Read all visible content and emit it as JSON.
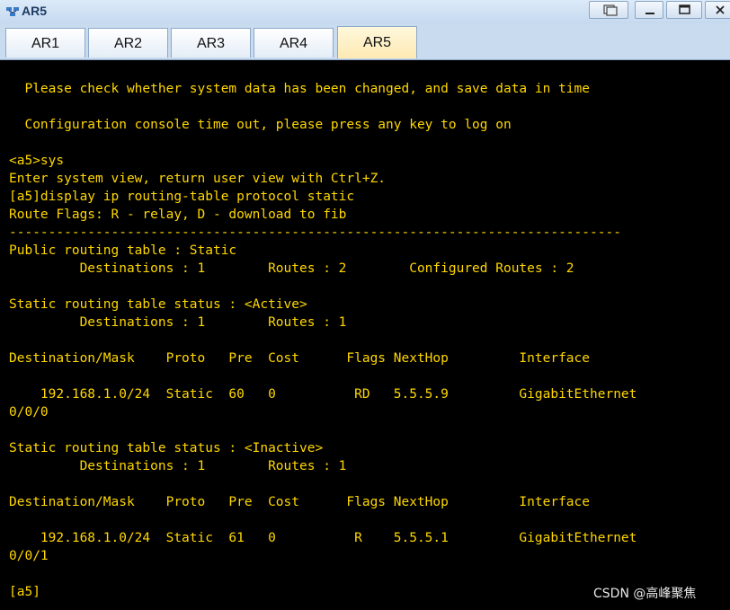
{
  "window": {
    "title": "AR5",
    "restore_icon": "restore-icon",
    "minimize_icon": "minimize-icon",
    "maximize_icon": "maximize-icon",
    "close_icon": "close-icon"
  },
  "tabs": [
    {
      "label": "AR1",
      "active": false
    },
    {
      "label": "AR2",
      "active": false
    },
    {
      "label": "AR3",
      "active": false
    },
    {
      "label": "AR4",
      "active": false
    },
    {
      "label": "AR5",
      "active": true
    }
  ],
  "console": {
    "text_color": "#ffd700",
    "background": "#000000",
    "lines": [
      "  Please check whether system data has been changed, and save data in time",
      "",
      "  Configuration console time out, please press any key to log on",
      "",
      "<a5>sys",
      "Enter system view, return user view with Ctrl+Z.",
      "[a5]display ip routing-table protocol static",
      "Route Flags: R - relay, D - download to fib",
      "------------------------------------------------------------------------------",
      "Public routing table : Static",
      "         Destinations : 1        Routes : 2        Configured Routes : 2",
      "",
      "Static routing table status : <Active>",
      "         Destinations : 1        Routes : 1",
      "",
      "Destination/Mask    Proto   Pre  Cost      Flags NextHop         Interface",
      "",
      "    192.168.1.0/24  Static  60   0          RD   5.5.5.9         GigabitEthernet",
      "0/0/0",
      "",
      "Static routing table status : <Inactive>",
      "         Destinations : 1        Routes : 1",
      "",
      "Destination/Mask    Proto   Pre  Cost      Flags NextHop         Interface",
      "",
      "    192.168.1.0/24  Static  61   0          R    5.5.5.1         GigabitEthernet",
      "0/0/1",
      "",
      "[a5]"
    ]
  },
  "watermark": "CSDN @高峰聚焦"
}
